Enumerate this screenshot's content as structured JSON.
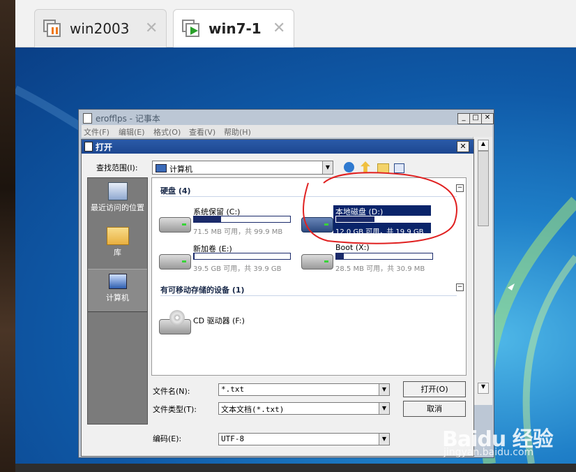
{
  "vm_tabs": [
    {
      "label": "win2003",
      "close": "✕"
    },
    {
      "label": "win7-1",
      "close": "✕"
    }
  ],
  "notepad": {
    "title": "erofflps - 记事本",
    "controls": [
      "_",
      "□",
      "✕"
    ],
    "menu": [
      "文件(F)",
      "编辑(E)",
      "格式(O)",
      "查看(V)",
      "帮助(H)"
    ]
  },
  "dialog": {
    "title": "打开",
    "close": "✕",
    "lookin_label": "查找范围(I):",
    "lookin_value": "计算机",
    "places": [
      "最近访问的位置",
      "库",
      "计算机"
    ],
    "groups": [
      {
        "title": "硬盘 (4)",
        "collapse": "−"
      },
      {
        "title": "有可移动存储的设备 (1)",
        "collapse": "−"
      }
    ],
    "drives": [
      {
        "name": "系统保留 (C:)",
        "free": "71.5 MB 可用，共 99.9 MB",
        "used": 0.28
      },
      {
        "name": "本地磁盘 (D:)",
        "free": "12.0 GB 可用，共 19.9 GB",
        "used": 0.4
      },
      {
        "name": "新加卷 (E:)",
        "free": "39.5 GB 可用，共 39.9 GB",
        "used": 0.01
      },
      {
        "name": "Boot (X:)",
        "free": "28.5 MB 可用，共 30.9 MB",
        "used": 0.08
      }
    ],
    "removable": [
      {
        "name": "CD 驱动器 (F:)"
      }
    ],
    "filename_label": "文件名(N):",
    "filename_value": "*.txt",
    "filetype_label": "文件类型(T):",
    "filetype_value": "文本文档(*.txt)",
    "encoding_label": "编码(E):",
    "encoding_value": "UTF-8",
    "open_button": "打开(O)",
    "cancel_button": "取消"
  },
  "watermark": {
    "logo": "Baidu 经验",
    "url": "jingyan.baidu.com"
  },
  "colors": {
    "annotation": "#e02020",
    "selection": "#0a246a",
    "titlebar": "#2a5aa8"
  }
}
